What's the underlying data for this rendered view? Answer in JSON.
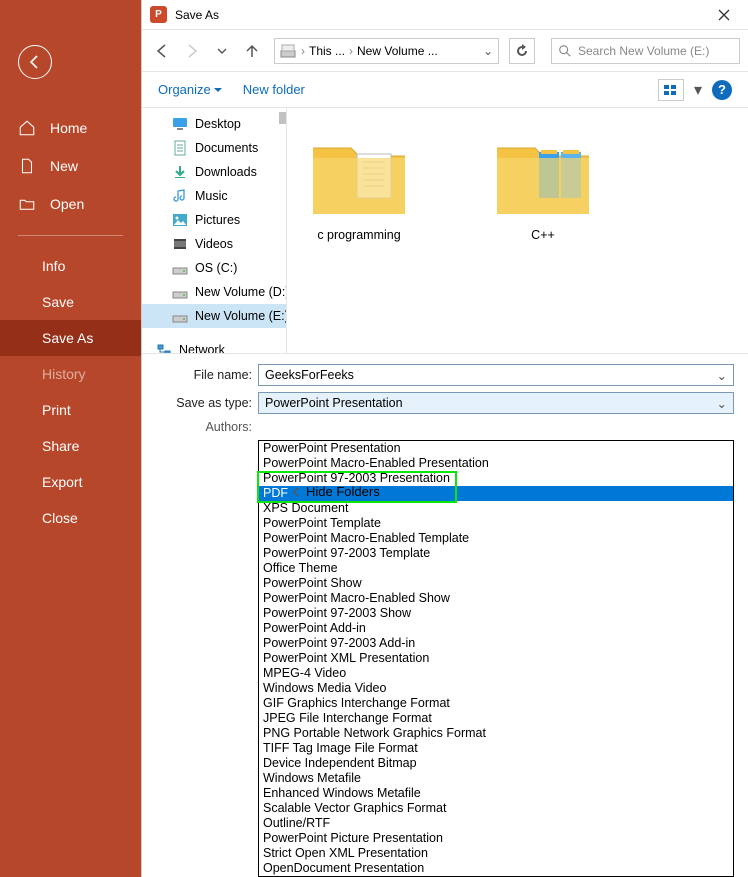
{
  "sidebar": {
    "home": "Home",
    "new": "New",
    "open": "Open",
    "info": "Info",
    "save": "Save",
    "saveAs": "Save As",
    "history": "History",
    "print": "Print",
    "share": "Share",
    "export": "Export",
    "close": "Close"
  },
  "dialog": {
    "title": "Save As",
    "breadcrumb": {
      "seg1": "This ...",
      "seg2": "New Volume ..."
    },
    "search_placeholder": "Search New Volume (E:)",
    "organize": "Organize",
    "newfolder": "New folder",
    "hide_folders": "Hide Folders"
  },
  "tree": [
    {
      "label": "Desktop",
      "icon": "desktop"
    },
    {
      "label": "Documents",
      "icon": "doc"
    },
    {
      "label": "Downloads",
      "icon": "down"
    },
    {
      "label": "Music",
      "icon": "music"
    },
    {
      "label": "Pictures",
      "icon": "pic"
    },
    {
      "label": "Videos",
      "icon": "vid"
    },
    {
      "label": "OS (C:)",
      "icon": "drive"
    },
    {
      "label": "New Volume (D:)",
      "icon": "drive"
    },
    {
      "label": "New Volume (E:)",
      "icon": "drive",
      "sel": true
    },
    {
      "label": "Network",
      "icon": "net",
      "net": true
    }
  ],
  "folders": [
    {
      "label": "c programming"
    },
    {
      "label": "C++"
    }
  ],
  "fields": {
    "filename_label": "File name:",
    "filename_value": "GeeksForFeeks",
    "type_label": "Save as type:",
    "type_value": "PowerPoint Presentation",
    "authors_label": "Authors:"
  },
  "options": [
    "PowerPoint Presentation",
    "PowerPoint Macro-Enabled Presentation",
    "PowerPoint 97-2003 Presentation",
    "PDF",
    "XPS Document",
    "PowerPoint Template",
    "PowerPoint Macro-Enabled Template",
    "PowerPoint 97-2003 Template",
    "Office Theme",
    "PowerPoint Show",
    "PowerPoint Macro-Enabled Show",
    "PowerPoint 97-2003 Show",
    "PowerPoint Add-in",
    "PowerPoint 97-2003 Add-in",
    "PowerPoint XML Presentation",
    "MPEG-4 Video",
    "Windows Media Video",
    "GIF Graphics Interchange Format",
    "JPEG File Interchange Format",
    "PNG Portable Network Graphics Format",
    "TIFF Tag Image File Format",
    "Device Independent Bitmap",
    "Windows Metafile",
    "Enhanced Windows Metafile",
    "Scalable Vector Graphics Format",
    "Outline/RTF",
    "PowerPoint Picture Presentation",
    "Strict Open XML Presentation",
    "OpenDocument Presentation"
  ],
  "selected_option_index": 3
}
